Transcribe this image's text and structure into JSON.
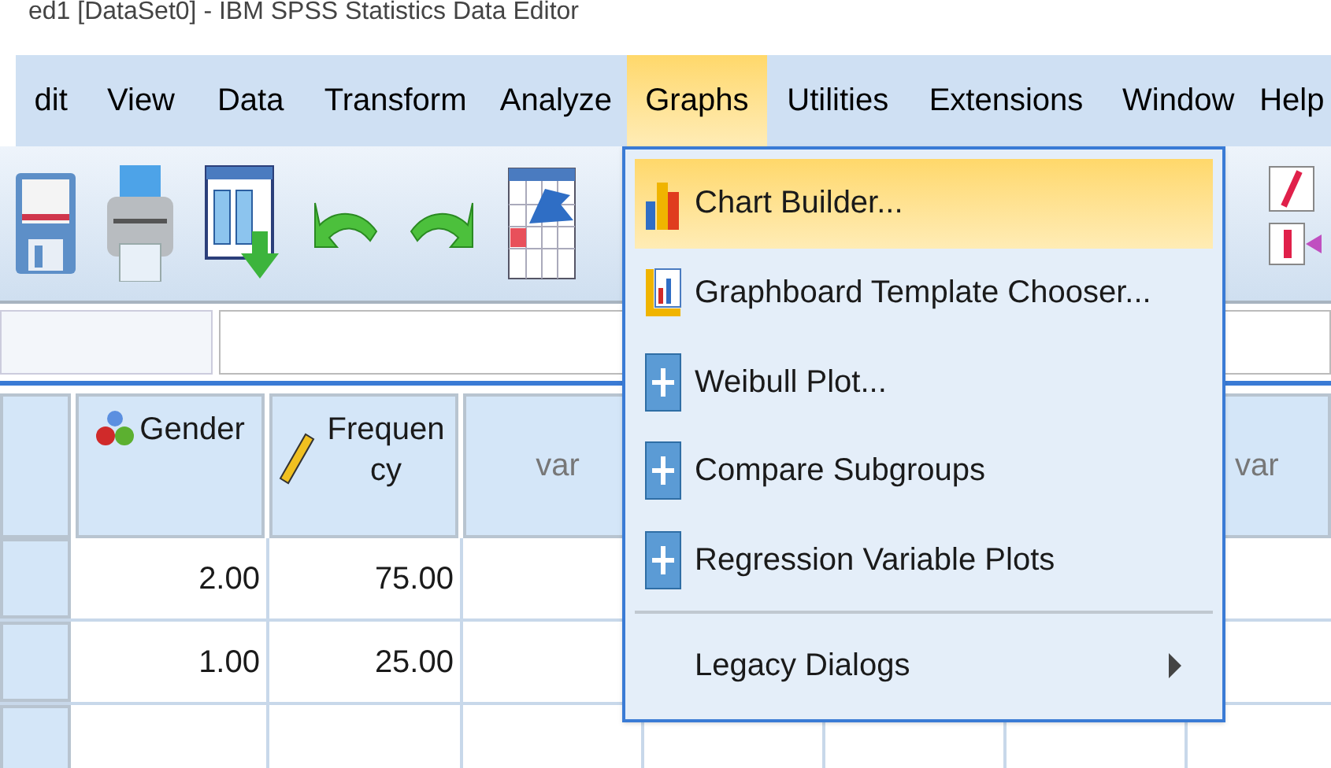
{
  "window": {
    "title": "ed1 [DataSet0] - IBM SPSS Statistics Data Editor"
  },
  "menu_bar": [
    {
      "label": "dit",
      "selected": false
    },
    {
      "label": "View",
      "selected": false
    },
    {
      "label": "Data",
      "selected": false
    },
    {
      "label": "Transform",
      "selected": false
    },
    {
      "label": "Analyze",
      "selected": false
    },
    {
      "label": "Graphs",
      "selected": true
    },
    {
      "label": "Utilities",
      "selected": false
    },
    {
      "label": "Extensions",
      "selected": false
    },
    {
      "label": "Window",
      "selected": false
    },
    {
      "label": "Help",
      "selected": false
    }
  ],
  "graphs_menu": [
    {
      "label": "Chart Builder...",
      "kind": "chart",
      "selected": true
    },
    {
      "label": "Graphboard Template Chooser...",
      "kind": "graphboard",
      "selected": false
    },
    {
      "label": "Weibull Plot...",
      "kind": "plus",
      "selected": false
    },
    {
      "label": "Compare Subgroups",
      "kind": "plus",
      "selected": false
    },
    {
      "label": "Regression Variable Plots",
      "kind": "plus",
      "selected": false
    },
    {
      "label": "Legacy Dialogs",
      "kind": "submenu",
      "selected": false
    }
  ],
  "grid": {
    "columns": [
      {
        "name": "Gender",
        "kind": "nominal"
      },
      {
        "name": "Frequency",
        "kind": "scale"
      },
      {
        "name": "var",
        "kind": "empty"
      }
    ],
    "right_column": {
      "name": "var"
    },
    "rows": [
      [
        "2.00",
        "75.00"
      ],
      [
        "1.00",
        "25.00"
      ]
    ]
  }
}
